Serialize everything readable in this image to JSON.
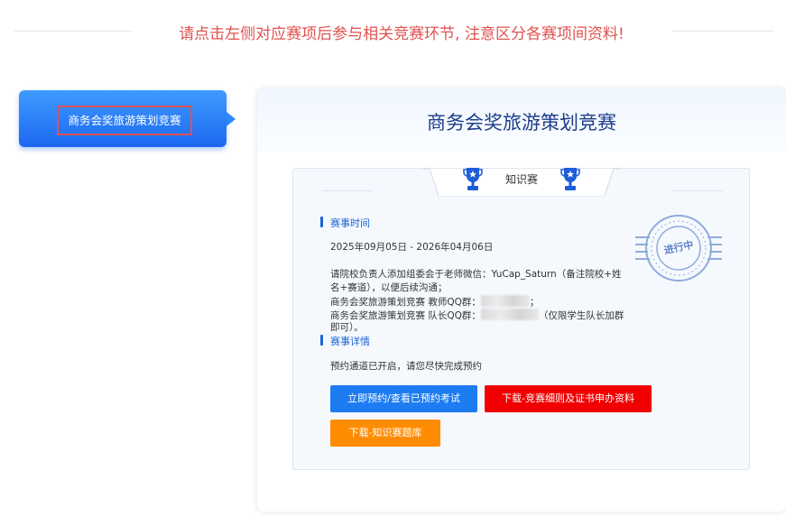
{
  "notice": "请点击左侧对应赛项后参与相关竞赛环节, 注意区分各赛项间资料!",
  "sidebar": {
    "active_item": "商务会奖旅游策划竞赛"
  },
  "card": {
    "title": "商务会奖旅游策划竞赛",
    "tab_label": "知识赛",
    "stamp_text": "进行中",
    "schedule_title": "赛事时间",
    "schedule": "2025年09月05日 - 2026年04月06日",
    "contact_line1": "请院校负责人添加组委会于老师微信：YuCap_Saturn（备注院校+姓",
    "contact_line2": "名+赛道），以便后续沟通；",
    "teacher_qq_prefix": "商务会奖旅游策划竞赛 教师QQ群：",
    "teacher_qq_suffix": "；",
    "captain_qq_prefix": "商务会奖旅游策划竞赛 队长QQ群：",
    "captain_qq_suffix": "（仅限学生队长加群",
    "captain_qq_line2": "即可）。",
    "details_title": "赛事详情",
    "details_text": "预约通道已开启，请您尽快完成预约",
    "buttons": {
      "reserve": "立即预约/查看已预约考试",
      "download_rules": "下载-竞赛细则及证书申办资料",
      "download_bank": "下载-知识赛题库"
    }
  },
  "colors": {
    "notice": "#e0524f",
    "primary_blue": "#1d7cf2",
    "red_button": "#f00000",
    "orange_button": "#ff8c00",
    "title_navy": "#1c3d8a"
  }
}
